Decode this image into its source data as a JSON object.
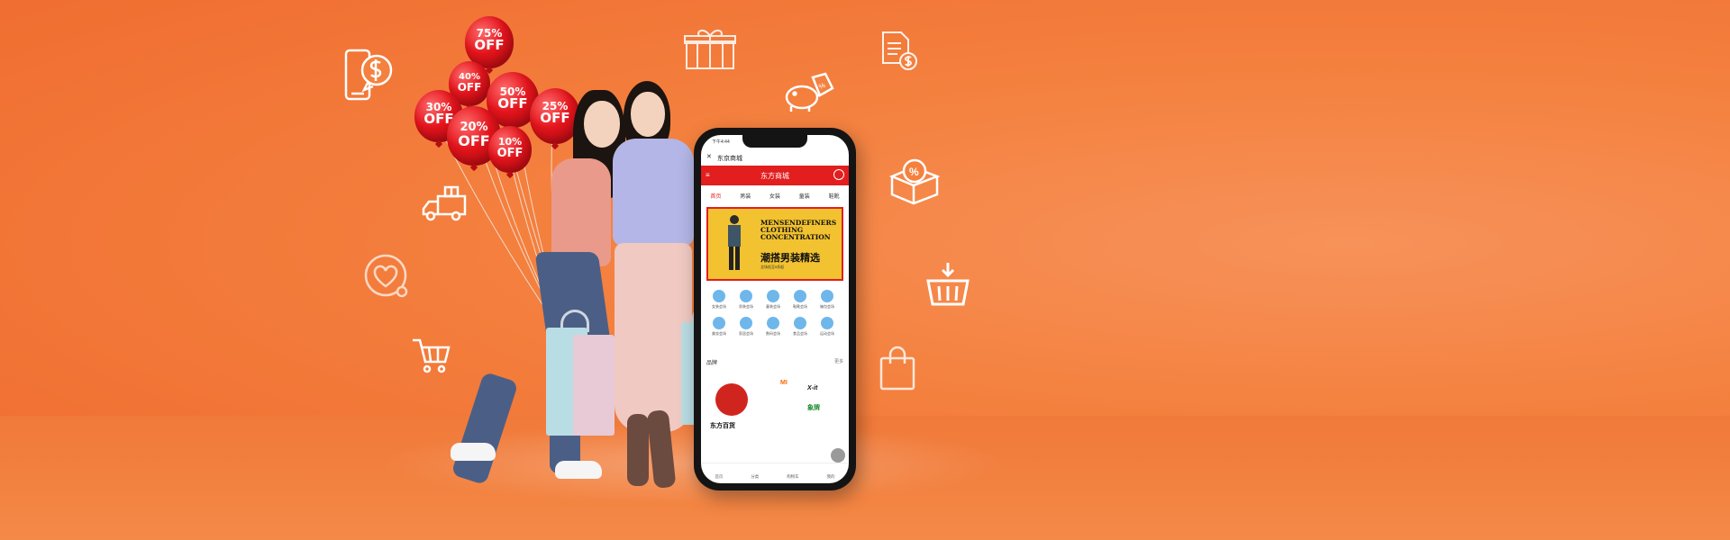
{
  "colors": {
    "background": "#f4813f",
    "balloon": "#e3141c",
    "app_red": "#e21e1e",
    "icon_stroke": "#ffffff",
    "promo_yellow": "#f2c230"
  },
  "balloons": [
    {
      "text": "75%",
      "off": "OFF"
    },
    {
      "text": "40%",
      "off": "OFF"
    },
    {
      "text": "50%",
      "off": "OFF"
    },
    {
      "text": "30%",
      "off": "OFF"
    },
    {
      "text": "25%",
      "off": "OFF"
    },
    {
      "text": "20%",
      "off": "OFF"
    },
    {
      "text": "10%",
      "off": "OFF"
    }
  ],
  "icons": [
    "phone-dollar-icon",
    "gift-box-icon",
    "receipt-dollar-icon",
    "piggy-bank-tag-icon",
    "discount-box-icon",
    "delivery-truck-icon",
    "heart-icon",
    "shopping-basket-icon",
    "shopping-cart-icon",
    "shopping-bag-icon"
  ],
  "phone": {
    "status_time": "下午4:44",
    "nav_close": "✕",
    "nav_title": "东京商城",
    "app_title": "东方商城",
    "tabs": [
      "首页",
      "男装",
      "女装",
      "童装",
      "鞋靴"
    ],
    "promo": {
      "line1": "MENSENDEFINERS",
      "line2": "CLOTHING",
      "line3": "CONCENTRATION",
      "title_cn": "潮搭男装精选",
      "subtitle": "全场低至5折起"
    },
    "grid_items": [
      "女装会场",
      "男装会场",
      "童装会场",
      "鞋靴会场",
      "箱包会场",
      "美妆会场",
      "家居会场",
      "数码会场",
      "食品会场",
      "运动会场"
    ],
    "section_title": "品牌",
    "section_more": "更多",
    "brand_name": "东方百货",
    "brand_logos": [
      "MI",
      "X-it",
      "象牌"
    ],
    "tabbar": [
      "首页",
      "分类",
      "购物车",
      "我的"
    ]
  }
}
